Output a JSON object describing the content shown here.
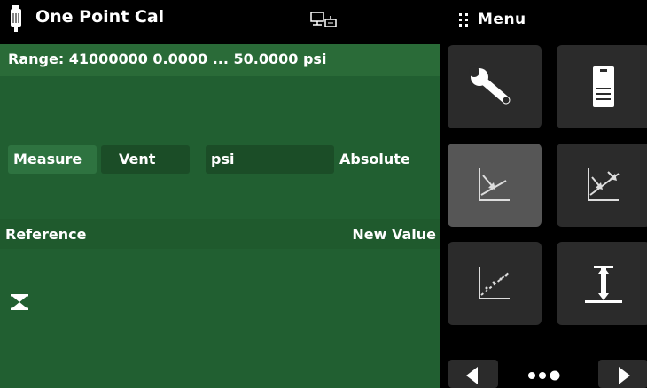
{
  "header": {
    "title": "One Point Cal",
    "menu_label": "Menu",
    "device_icon": "pressure-gauge-icon",
    "connection_icon": "remote-connection-icon",
    "menu_icon": "grid-dots-icon"
  },
  "panel": {
    "range_text": "Range: 41000000  0.0000 ... 50.0000 psi",
    "measure_label": "Measure",
    "vent_label": "Vent",
    "unit_label": "psi",
    "mode_label": "Absolute",
    "reference_label": "Reference",
    "new_value_label": "New Value",
    "status_icon": "hourglass-icon"
  },
  "menu_tiles": [
    {
      "icon": "wrench-icon"
    },
    {
      "icon": "document-icon"
    },
    {
      "icon": "one-point-cal-icon",
      "active": true
    },
    {
      "icon": "two-point-cal-icon"
    },
    {
      "icon": "linearization-cal-icon"
    },
    {
      "icon": "span-adjust-icon"
    }
  ],
  "pager": {
    "pages": 3,
    "current": 3
  },
  "colors": {
    "panel_green": "#215f31",
    "range_bar": "#2a6b38",
    "tile_bg": "#2b2b2b",
    "tile_active": "#565656"
  }
}
